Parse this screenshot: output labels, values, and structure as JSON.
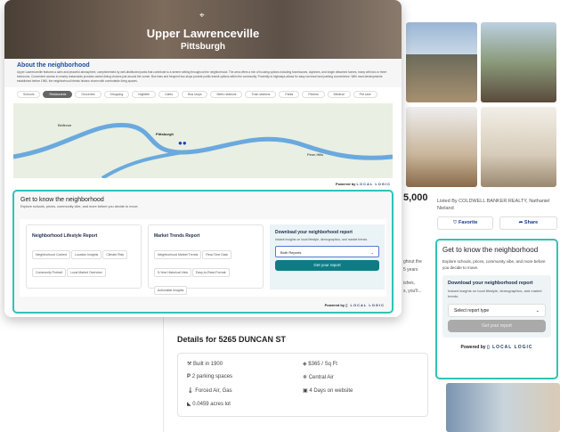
{
  "hero": {
    "title": "Upper Lawrenceville",
    "subtitle": "Pittsburgh"
  },
  "about": {
    "title": "About the neighborhood",
    "text": "Upper Lawrenceville features a calm and peaceful atmosphere, complemented by well-distributed parks that contribute to a serene setting throughout the neighborhood. The area offers a mix of housing options including townhouses, duplexes, and single detached homes, many with two or three bedrooms. Convenient access to nearby restaurants provides varied dining choices just around the corner. Bus lines and frequent bus stops provide public transit options within the community. Proximity to highways allows for easy car travel and parking convenience. With most developments established before 1960, the neighborhood blends historic charm with comfortable living spaces."
  },
  "chips": [
    "Schools",
    "Restaurants",
    "Groceries",
    "Shopping",
    "Nightlife",
    "Cafes",
    "Bus stops",
    "Metro stations",
    "Train stations",
    "Parks",
    "Fitness",
    "Medical",
    "Pet care"
  ],
  "map": {
    "labels": [
      "Bellevue",
      "Pittsburgh",
      "Penn Hills"
    ]
  },
  "powered": {
    "by": "Powered by",
    "brand": "LOCAL LOGIC"
  },
  "widget": {
    "title": "Get to know the neighborhood",
    "subtitle": "Explore schools, prices, community vibe, and more before you decide to move.",
    "lifestyle": {
      "title": "Neighborhood Lifestyle Report",
      "tags": [
        "Neighborhood Context",
        "Location Insights",
        "Climate Risk",
        "Community Portrait",
        "Local Market Overview"
      ]
    },
    "market": {
      "title": "Market Trends Report",
      "tags": [
        "Neighborhood Market Trends",
        "Real-Time Data",
        "5-Year Historical View",
        "Easy-to-Read Format",
        "Actionable Insights"
      ]
    },
    "download": {
      "title": "Download your neighborhood report",
      "text": "Instant insights on local lifestyle, demographics, and market trends.",
      "select": "Both Reports",
      "button": "Get your report"
    }
  },
  "listing": {
    "price": "5,000",
    "listed_by": "Listed By COLDWELL BANKER REALTY, Nathaniel Nieland",
    "favorite": "Favorite",
    "share": "Share",
    "frag1": "ghout the",
    "frag2": "5 years",
    "frag3": "ishes,",
    "frag4": "s, you'll..."
  },
  "side_widget": {
    "title": "Get to know the neighborhood",
    "subtitle": "Explore schools, prices, community vibe, and more before you decide to move.",
    "dl_title": "Download your neighborhood report",
    "dl_text": "Instant insights on local lifestyle, demographics, and market trends.",
    "select": "Select report type",
    "button": "Get your report"
  },
  "details": {
    "title": "Details for 5265 DUNCAN ST",
    "items": [
      "Built in 1900",
      "$365 / Sq Ft",
      "2 parking spaces",
      "Central Air",
      "Forced Air, Gas",
      "4 Days on website",
      "0.0459 acres lot"
    ]
  }
}
